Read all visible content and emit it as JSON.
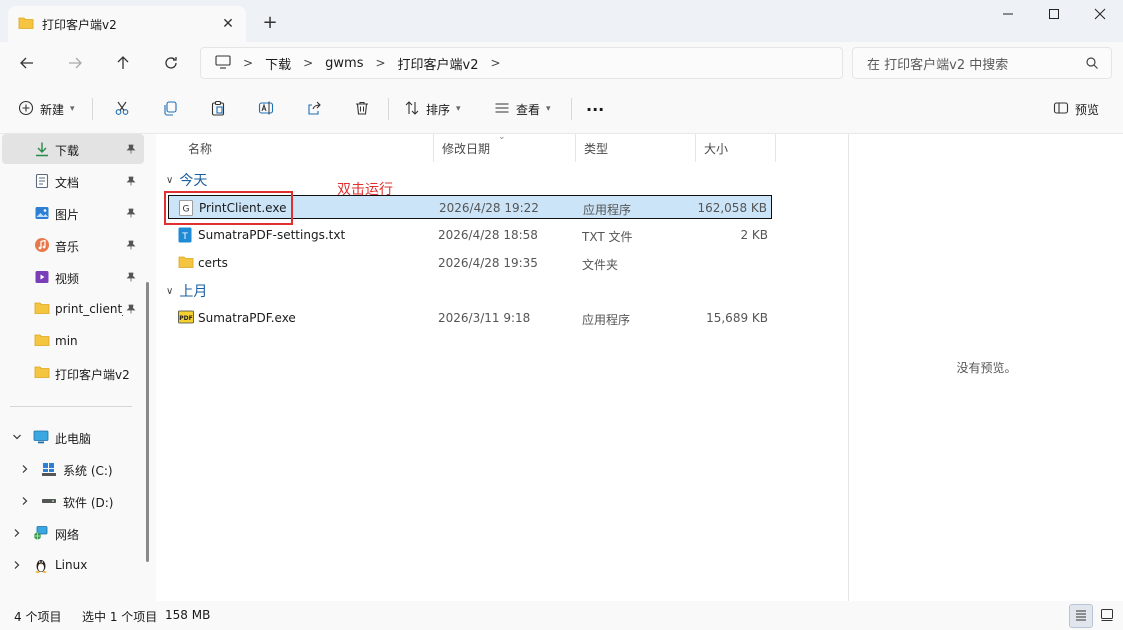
{
  "window": {
    "tab_title": "打印客户端v2",
    "tab_close": "✕",
    "new_tab": "+",
    "controls": [
      "minimize-icon",
      "maximize-icon",
      "close-icon"
    ]
  },
  "nav": {
    "breadcrumb": [
      "下载",
      "gwms",
      "打印客户端v2"
    ],
    "search_placeholder": "在 打印客户端v2 中搜索"
  },
  "toolbar": {
    "new_label": "新建",
    "sort_label": "排序",
    "view_label": "查看",
    "more_label": "···",
    "preview_label": "预览"
  },
  "sidebar": {
    "quick_access": [
      {
        "label": "下载",
        "icon": "download-icon",
        "pinned": true,
        "selected": true
      },
      {
        "label": "文档",
        "icon": "document-icon",
        "pinned": true
      },
      {
        "label": "图片",
        "icon": "picture-icon",
        "pinned": true
      },
      {
        "label": "音乐",
        "icon": "music-icon",
        "pinned": true
      },
      {
        "label": "视频",
        "icon": "video-icon",
        "pinned": true
      },
      {
        "label": "print_client_",
        "icon": "folder-icon",
        "pinned": true
      },
      {
        "label": "min",
        "icon": "folder-icon",
        "pinned": false
      },
      {
        "label": "打印客户端v2",
        "icon": "folder-icon",
        "pinned": false
      }
    ],
    "tree": [
      {
        "label": "此电脑",
        "icon": "pc-icon",
        "expanded": true
      },
      {
        "label": "系统 (C:)",
        "icon": "windows-drive-icon"
      },
      {
        "label": "软件 (D:)",
        "icon": "drive-icon"
      },
      {
        "label": "网络",
        "icon": "network-icon"
      },
      {
        "label": "Linux",
        "icon": "linux-icon"
      }
    ]
  },
  "columns": {
    "name": "名称",
    "modified": "修改日期",
    "type": "类型",
    "size": "大小"
  },
  "groups": {
    "today": "今天",
    "last_month": "上月"
  },
  "files": [
    {
      "name": "PrintClient.exe",
      "modified": "2026/4/28 19:22",
      "type": "应用程序",
      "size": "162,058 KB",
      "icon": "exe-icon",
      "selected": true
    },
    {
      "name": "SumatraPDF-settings.txt",
      "modified": "2026/4/28 18:58",
      "type": "TXT 文件",
      "size": "2 KB",
      "icon": "text-file-icon"
    },
    {
      "name": "certs",
      "modified": "2026/4/28 19:35",
      "type": "文件夹",
      "size": "",
      "icon": "folder-icon"
    },
    {
      "name": "SumatraPDF.exe",
      "modified": "2026/3/11 9:18",
      "type": "应用程序",
      "size": "15,689 KB",
      "icon": "pdf-app-icon"
    }
  ],
  "annotation": "双击运行",
  "preview": {
    "empty_text": "没有预览。"
  },
  "status": {
    "item_count": "4 个项目",
    "selection": "选中 1 个项目",
    "selection_size": "158 MB"
  },
  "colors": {
    "selection": "#cce4f7",
    "annotation": "#e03030",
    "folder": "#f5c542",
    "accent": "#1a5fa0"
  }
}
